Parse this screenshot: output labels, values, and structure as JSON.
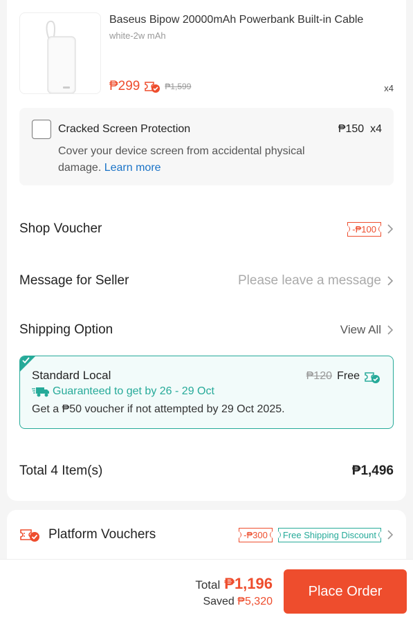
{
  "product": {
    "title": "Baseus Bipow 20000mAh Powerbank Built-in Cable",
    "variant": "white-2w mAh",
    "price": "₱299",
    "original_price": "₱1,599",
    "quantity": "x4",
    "image_icon": "powerbank-image"
  },
  "protection": {
    "title": "Cracked Screen Protection",
    "price": "₱150",
    "quantity": "x4",
    "description": "Cover your device screen from accidental physical damage. ",
    "link": "Learn more",
    "checked": false
  },
  "shop_voucher": {
    "label": "Shop Voucher",
    "value": "-₱100"
  },
  "message": {
    "label": "Message for Seller",
    "placeholder": "Please leave a message"
  },
  "shipping": {
    "label": "Shipping Option",
    "view_all": "View All",
    "option_title": "Standard Local",
    "old_fee": "₱120",
    "fee": "Free",
    "guarantee": "Guaranteed to get by 26 - 29 Oct",
    "note": "Get a ₱50 voucher if not attempted by 29 Oct 2025."
  },
  "summary": {
    "items_label": "Total 4 Item(s)",
    "items_total": "₱1,496"
  },
  "platform": {
    "label": "Platform Vouchers",
    "voucher": "-₱300",
    "shipping_discount": "Free Shipping Discount"
  },
  "footer": {
    "total_label": "Total",
    "total_value": "₱1,196",
    "saved_label": "Saved",
    "saved_value": "₱5,320",
    "place_order": "Place Order"
  },
  "colors": {
    "accent": "#ee4d2d",
    "teal": "#26aa99",
    "link": "#1a73c7"
  }
}
